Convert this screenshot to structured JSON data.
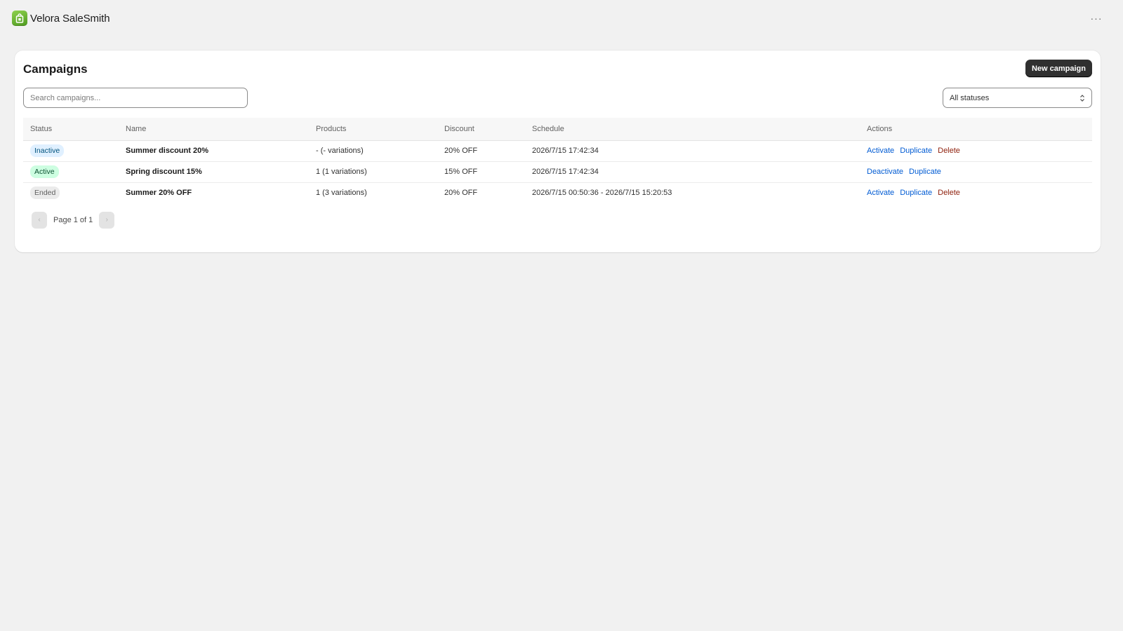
{
  "app": {
    "title": "Velora SaleSmith",
    "logo_icon": "shopping-bag-icon",
    "menu_icon": "more-horizontal-icon",
    "menu_glyph": "···"
  },
  "page": {
    "title": "Campaigns",
    "new_button_label": "New campaign"
  },
  "filters": {
    "search_placeholder": "Search campaigns...",
    "search_value": "",
    "status_selected": "All statuses"
  },
  "table": {
    "headers": {
      "status": "Status",
      "name": "Name",
      "products": "Products",
      "discount": "Discount",
      "schedule": "Schedule",
      "actions": "Actions"
    },
    "rows": [
      {
        "status": "Inactive",
        "name": "Summer discount 20%",
        "products": "- (- variations)",
        "discount": "20% OFF",
        "schedule": "2026/7/15 17:42:34",
        "actions": [
          "Activate",
          "Duplicate",
          "Delete"
        ]
      },
      {
        "status": "Active",
        "name": "Spring discount 15%",
        "products": "1 (1 variations)",
        "discount": "15% OFF",
        "schedule": "2026/7/15 17:42:34",
        "actions": [
          "Deactivate",
          "Duplicate"
        ]
      },
      {
        "status": "Ended",
        "name": "Summer 20% OFF",
        "products": "1 (3 variations)",
        "discount": "20% OFF",
        "schedule": "2026/7/15 00:50:36 - 2026/7/15 15:20:53",
        "actions": [
          "Activate",
          "Duplicate",
          "Delete"
        ]
      }
    ]
  },
  "pagination": {
    "label": "Page 1 of 1",
    "prev_icon": "chevron-left-icon",
    "next_icon": "chevron-right-icon",
    "prev_glyph": "‹",
    "next_glyph": "›"
  },
  "colors": {
    "background": "#f1f1f1",
    "primary_button": "#303030",
    "link": "#005bd3",
    "danger_link": "#8e1f0b",
    "badge_inactive": "#e0f0ff",
    "badge_active": "#cdfee1",
    "badge_ended": "#ebebeb",
    "logo_green": "#6bb535"
  }
}
